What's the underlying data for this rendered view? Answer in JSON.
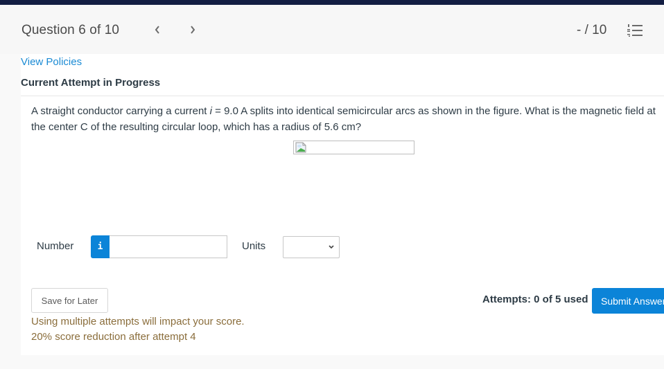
{
  "header": {
    "question_counter": "Question 6 of 10",
    "score": "- / 10",
    "prev_icon": "chevron-left-icon",
    "next_icon": "chevron-right-icon",
    "list_icon": "numbered-list-icon"
  },
  "content": {
    "view_policies_link": "View Policies",
    "attempt_title": "Current Attempt in Progress",
    "question": {
      "line1_before_var": "A straight conductor carrying a current ",
      "variable": "i",
      "line1_after_var": " = 9.0 A splits into identical semicircular arcs as shown in the figure. What is the magnetic field at",
      "line2": "the center C of the resulting circular loop, which has a radius of 5.6 cm?"
    },
    "figure_icon": "broken-image-icon"
  },
  "answer": {
    "number_label": "Number",
    "info_button_label": "i",
    "number_value": "",
    "units_label": "Units",
    "units_selected": ""
  },
  "footer": {
    "save_button": "Save for Later",
    "warning_line1": "Using multiple attempts will impact your score.",
    "warning_line2": "20% score reduction after attempt 4",
    "attempts_used": "Attempts: 0 of 5 used",
    "submit_button": "Submit Answer"
  },
  "colors": {
    "topbar": "#131e43",
    "link": "#1a8ad4",
    "primary": "#0b84d8",
    "warning": "#8a6d3b"
  }
}
